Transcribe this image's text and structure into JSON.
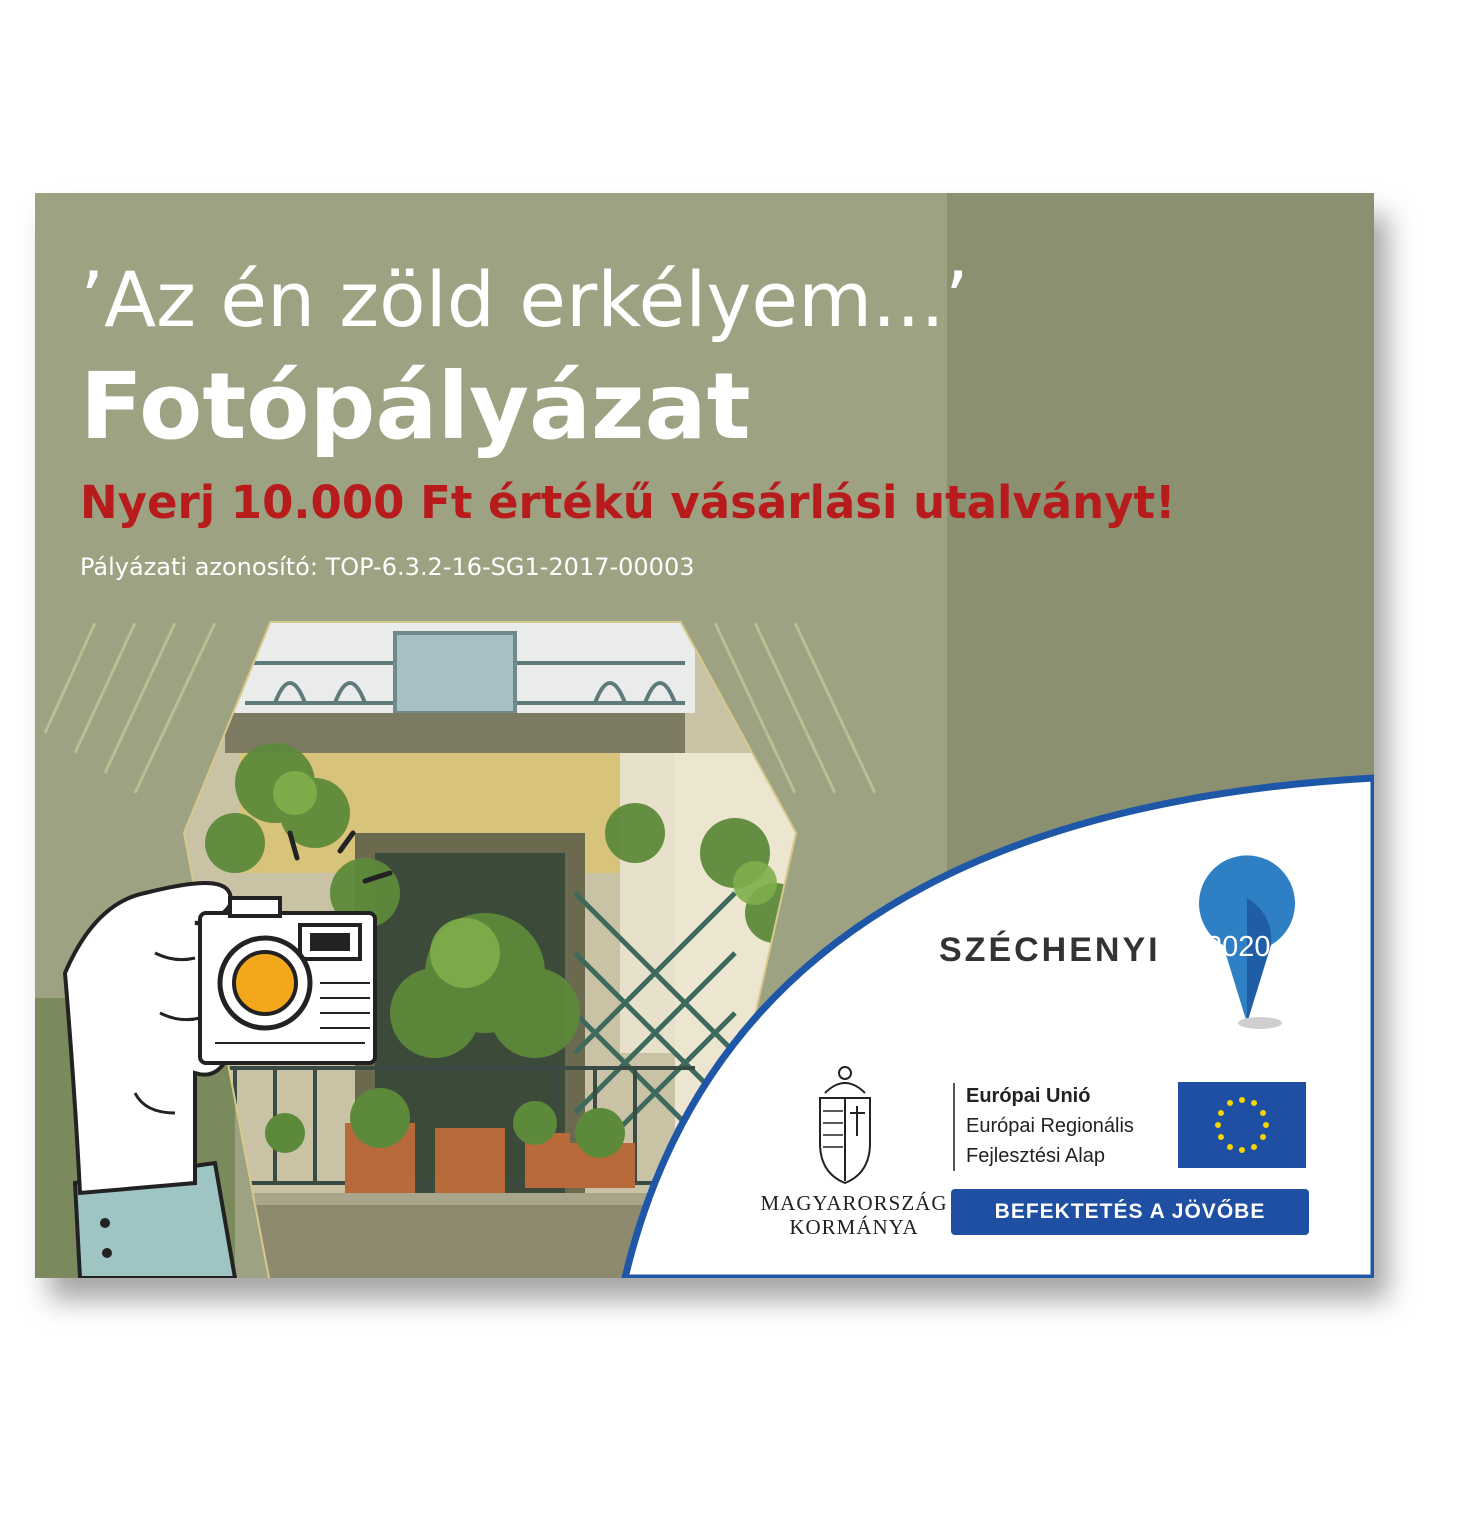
{
  "poster": {
    "title_line1": "’Az én zöld erkélyem...’",
    "title_line2": "Fotópályázat",
    "subtitle": "Nyerj 10.000 Ft értékű vásárlási utalványt!",
    "project_id": "Pályázati azonosító: TOP-6.3.2-16-SG1-2017-00003"
  },
  "logos": {
    "szechenyi_label": "SZÉCHENYI",
    "szechenyi_year": "2020",
    "government_line1": "MAGYARORSZÁG",
    "government_line2": "KORMÁNYA",
    "eu_line1": "Európai Unió",
    "eu_line2": "Európai Regionális",
    "eu_line3": "Fejlesztési Alap",
    "invest_label": "BEFEKTETÉS A JÖVŐBE"
  },
  "colors": {
    "background_green": "#9da283",
    "band_green": "#8a9070",
    "accent_red": "#b81b1b",
    "eu_blue": "#1f4fa3"
  },
  "icons": [
    "camera-icon",
    "hand-illustration",
    "location-pin-icon",
    "coat-of-arms-icon",
    "eu-flag-icon"
  ]
}
